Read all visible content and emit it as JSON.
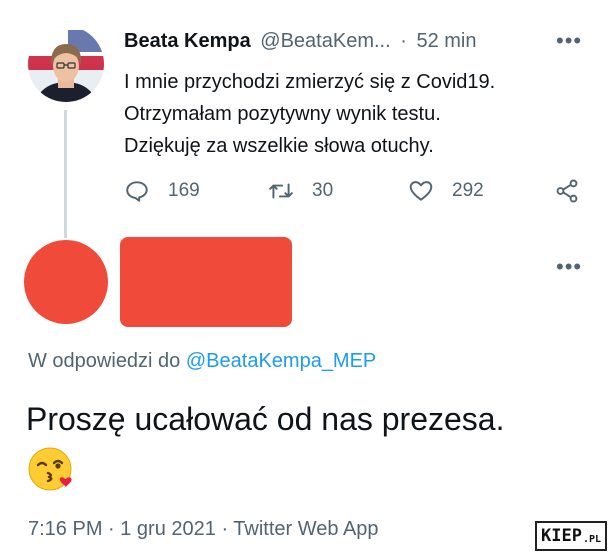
{
  "original_tweet": {
    "author_name": "Beata Kempa",
    "author_handle": "@BeataKem...",
    "separator": "·",
    "time_ago": "52 min",
    "more_label": "•••",
    "text_lines": [
      "I mnie przychodzi zmierzyć się z Covid19.",
      "Otrzymałam pozytywny wynik testu.",
      "Dziękuję za wszelkie słowa otuchy."
    ],
    "actions": {
      "replies": "169",
      "retweets": "30",
      "likes": "292"
    },
    "icons": [
      "reply-icon",
      "retweet-icon",
      "like-icon",
      "share-icon"
    ]
  },
  "reply_tweet": {
    "more_label": "•••",
    "reply_prefix": "W odpowiedzi do",
    "reply_handle": "@BeataKempa_MEP",
    "text": "Proszę ucałować od nas prezesa.",
    "emoji": "kissing-face-with-heart-emoji",
    "timestamp": "7:16 PM · 1 gru 2021 · Twitter Web App"
  },
  "watermark": {
    "main": "KIEP",
    "suffix": ".PL"
  },
  "colors": {
    "text": "#0f1419",
    "muted": "#536471",
    "link": "#1d9bf0",
    "redaction": "#f04a3a",
    "thread_line": "#cfd9de"
  }
}
